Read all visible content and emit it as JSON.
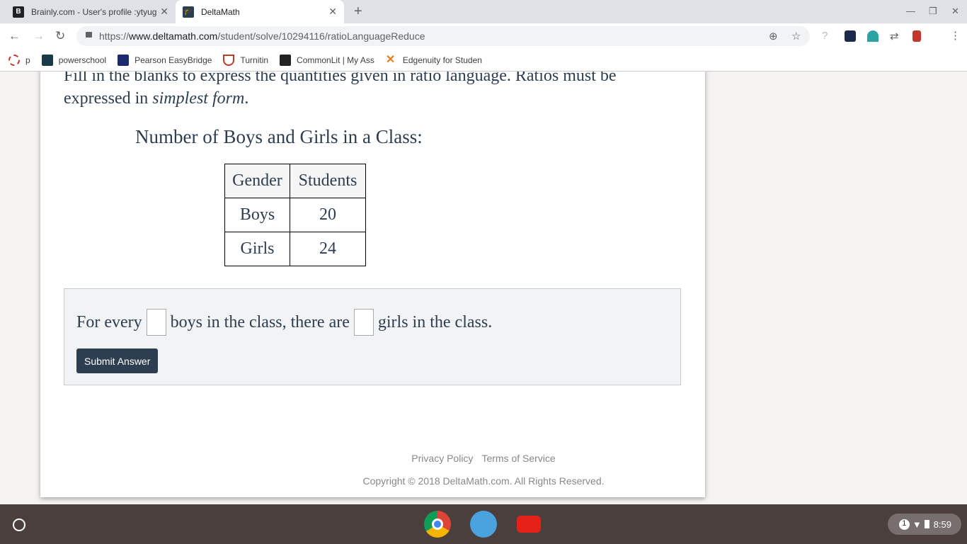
{
  "tabs": [
    {
      "title": "Brainly.com - User's profile :ytyug",
      "favicon": "B"
    },
    {
      "title": "DeltaMath",
      "favicon": "mortarboard-icon"
    }
  ],
  "url": {
    "scheme": "https://",
    "host": "www.deltamath.com",
    "path": "/student/solve/10294116/ratioLanguageReduce"
  },
  "bookmarks": [
    {
      "label": "p",
      "color": "#c0392b"
    },
    {
      "label": "powerschool",
      "color": "#1a3a4a"
    },
    {
      "label": "Pearson EasyBridge",
      "color": "#1a2a6c"
    },
    {
      "label": "Turnitin",
      "color": "#c0392b"
    },
    {
      "label": "CommonLit | My Ass",
      "color": "#222222"
    },
    {
      "label": "Edgenuity for Studen",
      "color": "#e67e22"
    }
  ],
  "problem": {
    "instructions_pre": "Fill in the blanks to express the quantities given in ratio language. Ratios must be expressed in ",
    "instructions_em": "simplest form",
    "instructions_post": ".",
    "table_title": "Number of Boys and Girls in a Class:",
    "table": {
      "headers": [
        "Gender",
        "Students"
      ],
      "rows": [
        [
          "Boys",
          "20"
        ],
        [
          "Girls",
          "24"
        ]
      ]
    },
    "sentence": [
      "For every",
      "boys in the class, there are",
      "girls in the class."
    ],
    "blanks": [
      "",
      ""
    ],
    "submit": "Submit Answer"
  },
  "footer": {
    "privacy": "Privacy Policy",
    "terms": "Terms of Service",
    "copyright": "Copyright © 2018 DeltaMath.com. All Rights Reserved."
  },
  "taskbar": {
    "time": "8:59",
    "notifications": "1"
  },
  "colors": {
    "accent": "#2c3e50"
  }
}
